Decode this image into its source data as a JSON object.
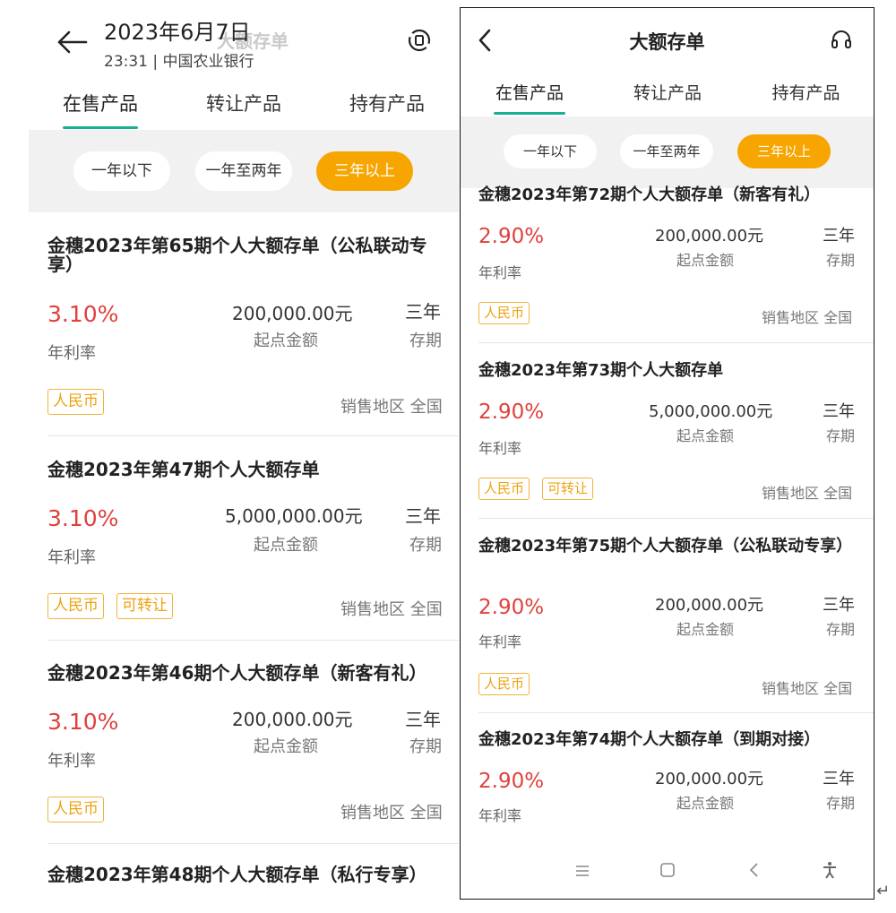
{
  "left": {
    "header": {
      "ghost_title": "大额存单",
      "date": "2023年6月7日",
      "time_source": "23:31 | 中国农业银行"
    },
    "tabs": [
      {
        "label": "在售产品",
        "active": true
      },
      {
        "label": "转让产品",
        "active": false
      },
      {
        "label": "持有产品",
        "active": false
      }
    ],
    "filters": [
      {
        "label": "一年以下",
        "active": false
      },
      {
        "label": "一年至两年",
        "active": false
      },
      {
        "label": "三年以上",
        "active": true
      }
    ],
    "products": [
      {
        "title": "金穗2023年第65期个人大额存单（公私联动专享）",
        "rate": "3.10%",
        "rate_label": "年利率",
        "amount": "200,000.00元",
        "amount_label": "起点金额",
        "term": "三年",
        "term_label": "存期",
        "tags": [
          "人民币"
        ],
        "region": "销售地区 全国"
      },
      {
        "title": "金穗2023年第47期个人大额存单",
        "rate": "3.10%",
        "rate_label": "年利率",
        "amount": "5,000,000.00元",
        "amount_label": "起点金额",
        "term": "三年",
        "term_label": "存期",
        "tags": [
          "人民币",
          "可转让"
        ],
        "region": "销售地区 全国"
      },
      {
        "title": "金穗2023年第46期个人大额存单（新客有礼）",
        "rate": "3.10%",
        "rate_label": "年利率",
        "amount": "200,000.00元",
        "amount_label": "起点金额",
        "term": "三年",
        "term_label": "存期",
        "tags": [
          "人民币"
        ],
        "region": "销售地区 全国"
      },
      {
        "title": "金穗2023年第48期个人大额存单（私行专享）"
      }
    ]
  },
  "right": {
    "header": {
      "title": "大额存单"
    },
    "tabs": [
      {
        "label": "在售产品",
        "active": true
      },
      {
        "label": "转让产品",
        "active": false
      },
      {
        "label": "持有产品",
        "active": false
      }
    ],
    "filters": [
      {
        "label": "一年以下",
        "active": false
      },
      {
        "label": "一年至两年",
        "active": false
      },
      {
        "label": "三年以上",
        "active": true
      }
    ],
    "products": [
      {
        "title": "金穗2023年第72期个人大额存单（新客有礼）",
        "rate": "2.90%",
        "rate_label": "年利率",
        "amount": "200,000.00元",
        "amount_label": "起点金额",
        "term": "三年",
        "term_label": "存期",
        "tags": [
          "人民币"
        ],
        "region": "销售地区 全国"
      },
      {
        "title": "金穗2023年第73期个人大额存单",
        "rate": "2.90%",
        "rate_label": "年利率",
        "amount": "5,000,000.00元",
        "amount_label": "起点金额",
        "term": "三年",
        "term_label": "存期",
        "tags": [
          "人民币",
          "可转让"
        ],
        "region": "销售地区 全国"
      },
      {
        "title": "金穗2023年第75期个人大额存单（公私联动专享）",
        "rate": "2.90%",
        "rate_label": "年利率",
        "amount": "200,000.00元",
        "amount_label": "起点金额",
        "term": "三年",
        "term_label": "存期",
        "tags": [
          "人民币"
        ],
        "region": "销售地区 全国"
      },
      {
        "title": "金穗2023年第74期个人大额存单（到期对接）",
        "rate": "2.90%",
        "rate_label": "年利率",
        "amount": "200,000.00元",
        "amount_label": "起点金额",
        "term": "三年",
        "term_label": "存期",
        "tags": [],
        "region": ""
      }
    ],
    "navbar": [
      "menu-icon",
      "home-icon",
      "back-icon",
      "accessibility-icon"
    ]
  },
  "colors": {
    "accent": "#1aae94",
    "rate": "#e0403c",
    "chip_active": "#f7a500",
    "tag": "#eca312"
  },
  "return_mark": "↵"
}
